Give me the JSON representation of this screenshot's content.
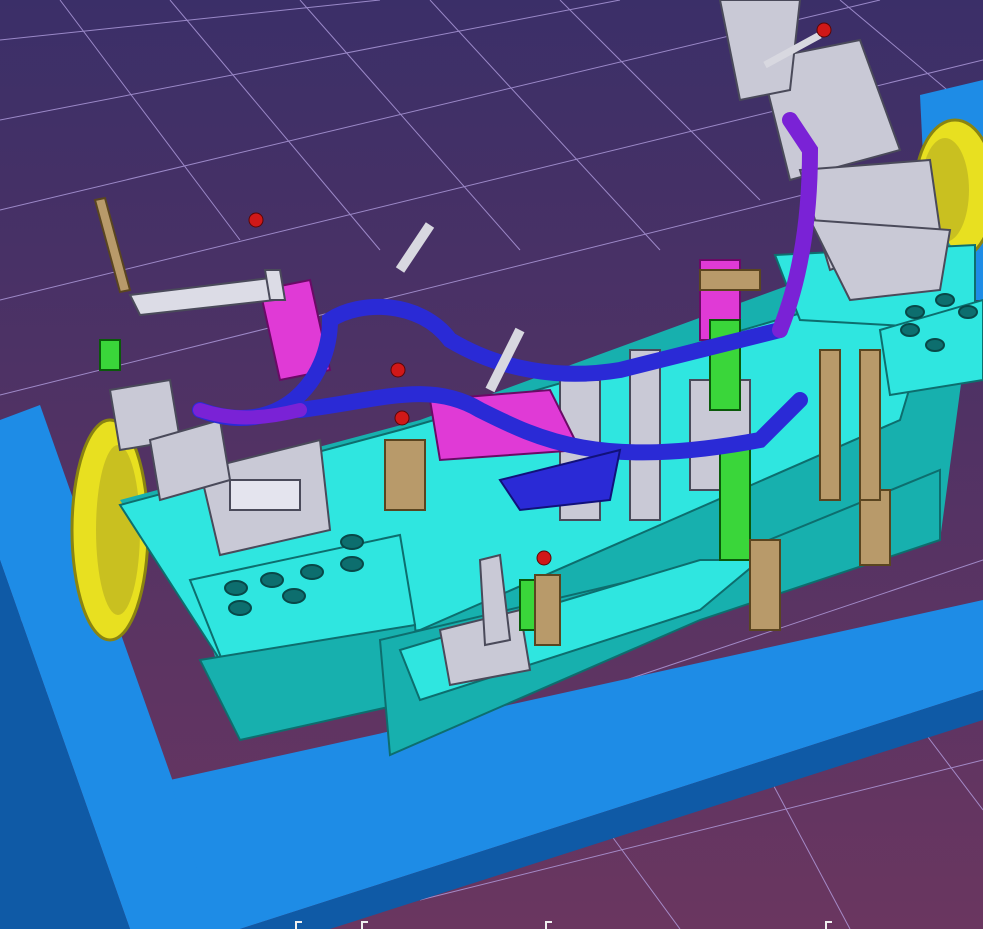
{
  "viewport": {
    "background_top": "#3b2f68",
    "background_bottom": "#6a3660",
    "grid_color": "#b9a6e8",
    "colors": {
      "base_blue": "#1e8ce6",
      "base_blue_dark": "#0f5aa6",
      "plate_cyan": "#2fe6e0",
      "plate_cyan_dark": "#17b0ae",
      "fixture_gray": "#c9c9d6",
      "frame_blue": "#2a2ad6",
      "frame_violet": "#7a22d6",
      "magenta": "#e03ad6",
      "green": "#3ad63a",
      "tan": "#b89a6a",
      "yellow_wheel": "#e8e020",
      "knob_red": "#d01818"
    },
    "icons": [
      "ruler-marker-icon"
    ]
  }
}
